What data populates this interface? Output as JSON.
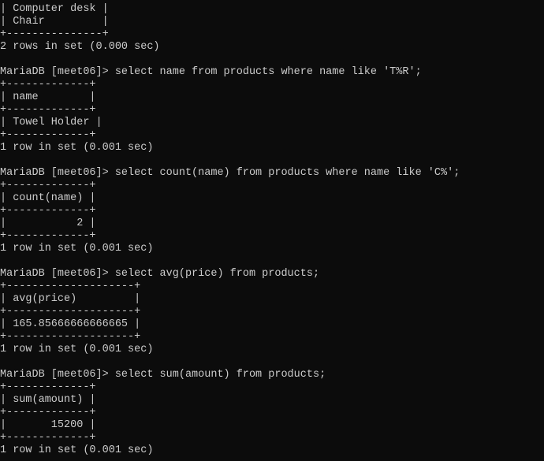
{
  "terminal": {
    "colors": {
      "background": "#0c0c0c",
      "foreground": "#cccccc"
    },
    "lines": [
      "| Computer desk |",
      "| Chair         |",
      "+---------------+",
      "2 rows in set (0.000 sec)",
      "",
      "MariaDB [meet06]> select name from products where name like 'T%R';",
      "+-------------+",
      "| name        |",
      "+-------------+",
      "| Towel Holder |",
      "+-------------+",
      "1 row in set (0.001 sec)",
      "",
      "MariaDB [meet06]> select count(name) from products where name like 'C%';",
      "+-------------+",
      "| count(name) |",
      "+-------------+",
      "|           2 |",
      "+-------------+",
      "1 row in set (0.001 sec)",
      "",
      "MariaDB [meet06]> select avg(price) from products;",
      "+--------------------+",
      "| avg(price)         |",
      "+--------------------+",
      "| 165.85666666666665 |",
      "+--------------------+",
      "1 row in set (0.001 sec)",
      "",
      "MariaDB [meet06]> select sum(amount) from products;",
      "+-------------+",
      "| sum(amount) |",
      "+-------------+",
      "|       15200 |",
      "+-------------+",
      "1 row in set (0.001 sec)"
    ]
  }
}
